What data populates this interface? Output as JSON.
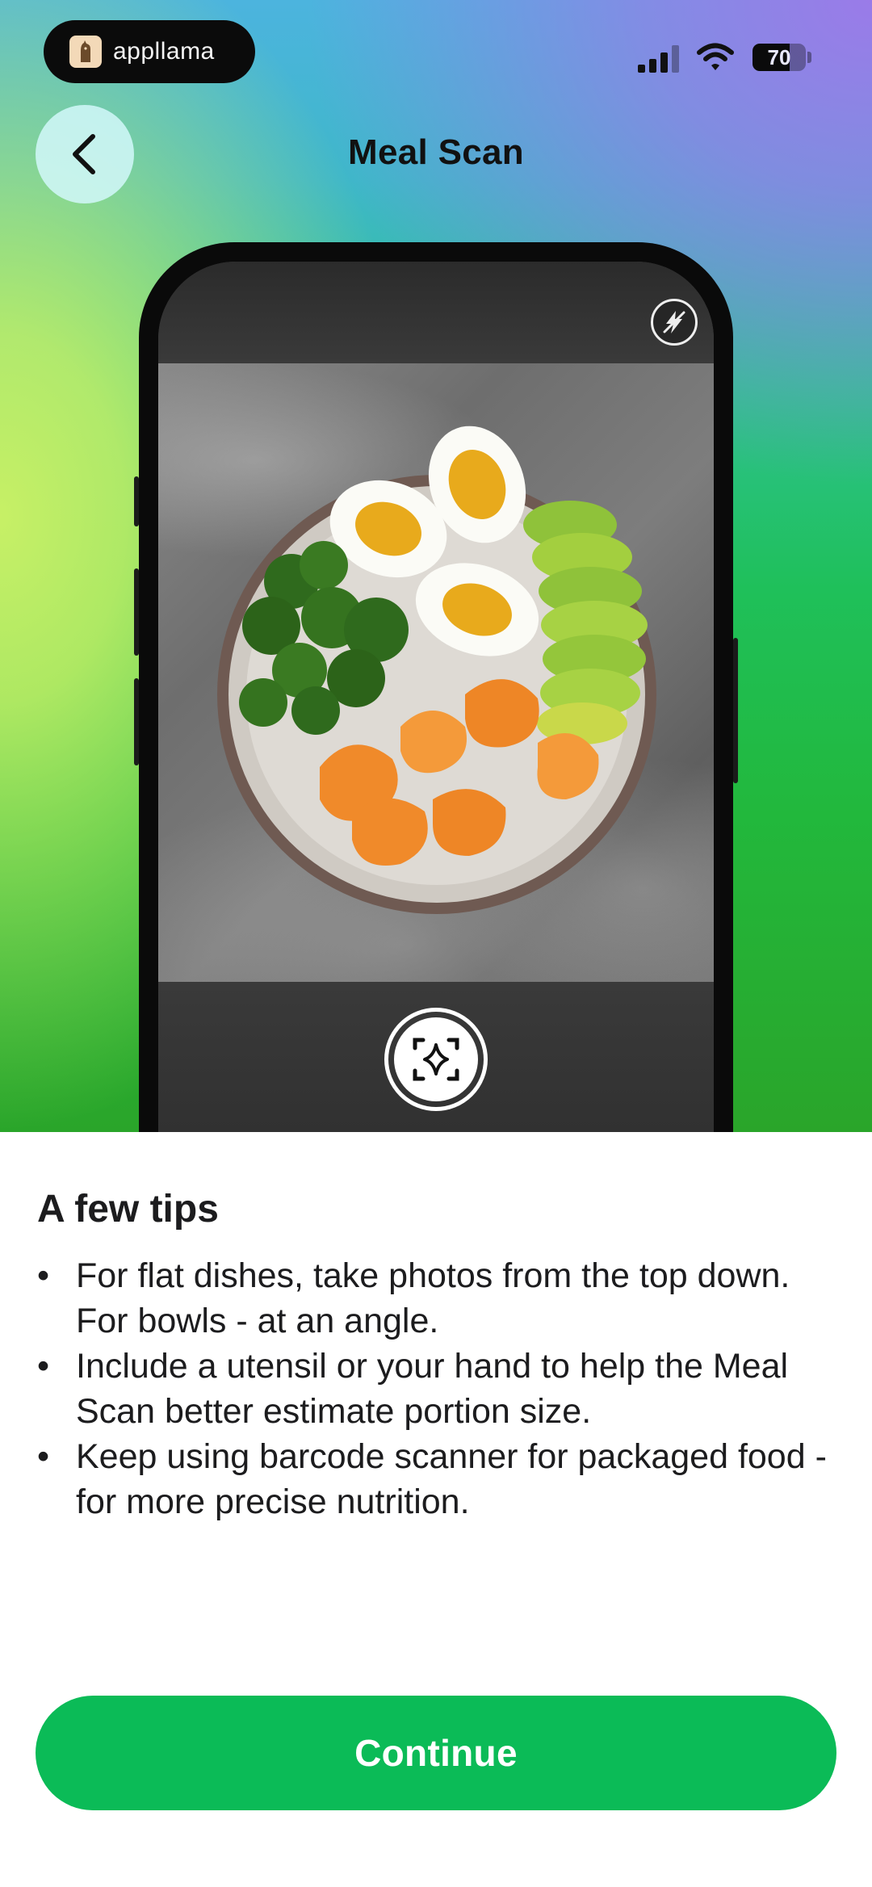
{
  "status_bar": {
    "app_name": "appllama",
    "battery": "70",
    "icons": [
      "signal-icon",
      "wifi-icon",
      "battery-icon"
    ]
  },
  "header": {
    "title": "Meal Scan",
    "back_icon": "chevron-left-icon"
  },
  "camera": {
    "flash_icon": "flash-off-icon",
    "shutter_icon": "ai-scan-sparkle-icon",
    "preview_subject": "plate-with-eggs-broccoli-avocado-shrimp"
  },
  "tips": {
    "title": "A few tips",
    "items": [
      "For flat dishes, take photos from the top down. For bowls - at an angle.",
      "Include a utensil or your hand to help the Meal Scan better estimate portion size.",
      "Keep using barcode scanner for packaged food - for more precise nutrition."
    ]
  },
  "continue_label": "Continue",
  "colors": {
    "accent_green": "#0bbb57",
    "title_text": "#1c1c1e"
  }
}
